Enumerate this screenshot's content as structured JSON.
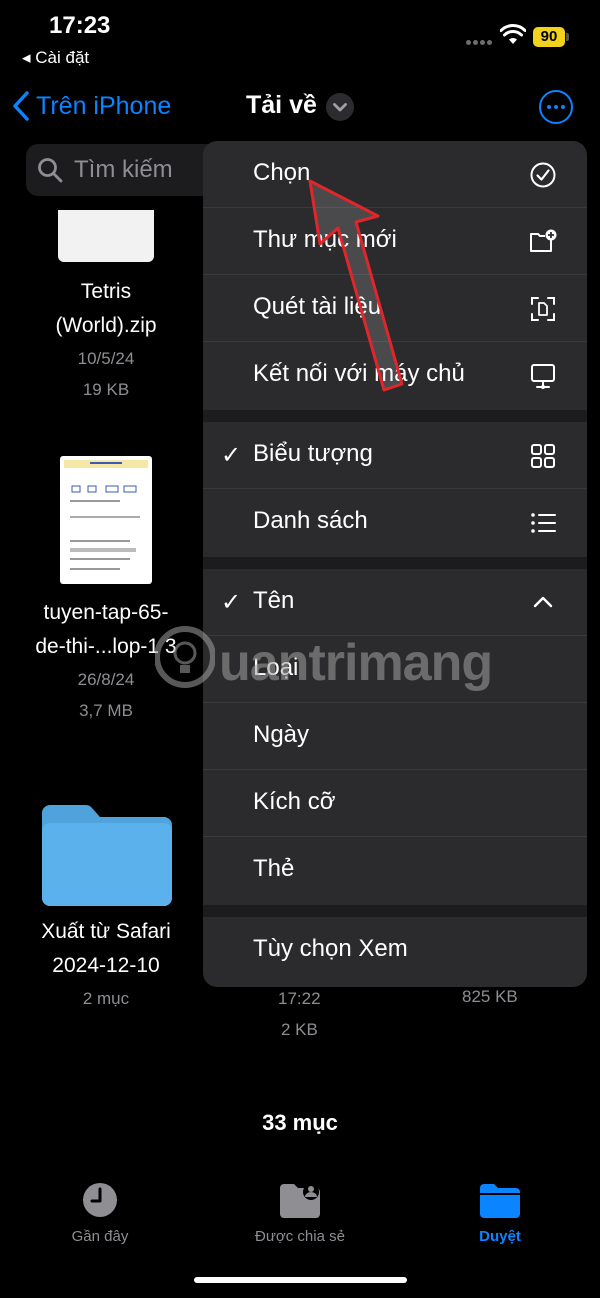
{
  "status": {
    "time": "17:23",
    "back_app": "Cài đặt",
    "battery": "90"
  },
  "nav": {
    "back_label": "Trên iPhone",
    "title": "Tải về"
  },
  "search": {
    "placeholder": "Tìm kiếm"
  },
  "files": [
    {
      "name_line1": "Tetris",
      "name_line2": "(World).zip",
      "date": "10/5/24",
      "size": "19 KB"
    },
    {
      "name_line1": "tuyen-tap-65-",
      "name_line2": "de-thi-...lop-1 3",
      "date": "26/8/24",
      "size": "3,7 MB"
    },
    {
      "name_line1": "Xuất từ Safari",
      "name_line2": "2024-12-10",
      "date": "2 mục"
    }
  ],
  "hidden_meta": {
    "time": "17:22",
    "size_a": "2 KB",
    "size_b": "825 KB"
  },
  "menu": {
    "items": [
      {
        "label": "Chọn",
        "icon": "checkmark-circle-icon"
      },
      {
        "label": "Thư mục mới",
        "icon": "folder-badge-plus-icon"
      },
      {
        "label": "Quét tài liệu",
        "icon": "doc-viewfinder-icon"
      },
      {
        "label": "Kết nối với máy chủ",
        "icon": "desktop-computer-icon"
      },
      {
        "label": "Biểu tượng",
        "icon": "grid-icon",
        "checked": true
      },
      {
        "label": "Danh sách",
        "icon": "list-icon"
      },
      {
        "label": "Tên",
        "icon": "chevron-up-icon",
        "checked": true
      },
      {
        "label": "Loại"
      },
      {
        "label": "Ngày"
      },
      {
        "label": "Kích cỡ"
      },
      {
        "label": "Thẻ"
      },
      {
        "label": "Tùy chọn Xem"
      }
    ]
  },
  "footer": {
    "count": "33 mục"
  },
  "tabs": [
    {
      "label": "Gần đây",
      "icon": "clock-icon"
    },
    {
      "label": "Được chia sẻ",
      "icon": "shared-folder-icon"
    },
    {
      "label": "Duyệt",
      "icon": "folder-icon",
      "active": true
    }
  ],
  "colors": {
    "accent": "#0a84ff",
    "battery": "#f2d21c",
    "folder": "#5ab1ec",
    "annotation": "#e0262a"
  },
  "watermark": {
    "text": "uantrimang"
  }
}
